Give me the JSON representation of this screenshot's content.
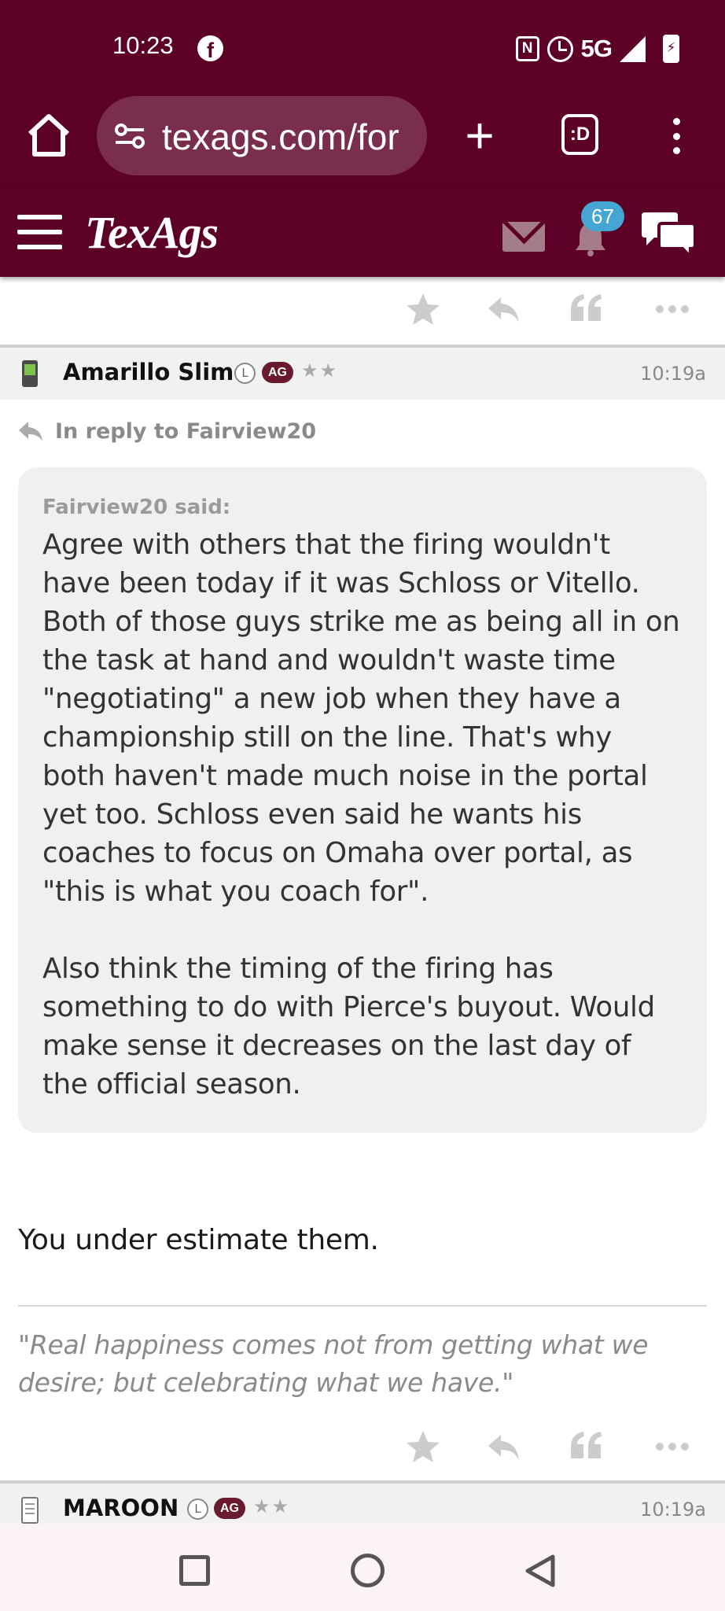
{
  "status_bar": {
    "time": "10:23",
    "notification_app": "f",
    "nfc_label": "N",
    "network": "5G"
  },
  "browser": {
    "url": "texags.com/for",
    "tabs_label": ":D"
  },
  "site": {
    "logo": "TexAgs",
    "notification_count": "67"
  },
  "posts": [
    {
      "username": "Amarillo Slim",
      "badge_l": "L",
      "badge_ag": "AG",
      "stars": "★★",
      "time": "10:19a",
      "in_reply_to": "In reply to Fairview20",
      "quote": {
        "author": "Fairview20 said:",
        "paragraph_1": "Agree with others that the firing wouldn't have been today if it was Schloss or Vitello. Both of those guys strike me as being all in on the task at hand and wouldn't waste time \"negotiating\" a new job when they have a championship still on the line. That's why both haven't made much noise in the portal yet too. Schloss even said he wants his coaches to focus on Omaha over portal, as \"this is what you coach for\".",
        "paragraph_2": "Also think the timing of the firing has something to do with Pierce's buyout. Would make sense it decreases on the last day of the official season."
      },
      "body": "You under estimate them.",
      "signature": "\"Real happiness comes not from getting what we desire; but celebrating what we have.\""
    },
    {
      "username": "MAROON",
      "badge_l": "L",
      "badge_ag": "AG",
      "stars": "★★",
      "time": "10:19a"
    }
  ],
  "icons": {
    "home": "home-icon",
    "site_settings": "tune-icon",
    "new_tab": "plus-icon",
    "menu": "more-vert-icon",
    "hamburger": "hamburger-icon",
    "mail": "mail-icon",
    "notifications": "bell-icon",
    "chat": "chat-icon",
    "star": "star-icon",
    "reply": "reply-icon",
    "quote": "quote-icon",
    "more": "more-horiz-icon"
  },
  "colors": {
    "brand_maroon": "#5c0025",
    "badge_blue": "#45a6d4",
    "ag_badge": "#6a1a2e",
    "post_header_bg": "#f1f1f1",
    "quote_bg": "#f0f0f0",
    "action_icon": "#cccccc"
  }
}
